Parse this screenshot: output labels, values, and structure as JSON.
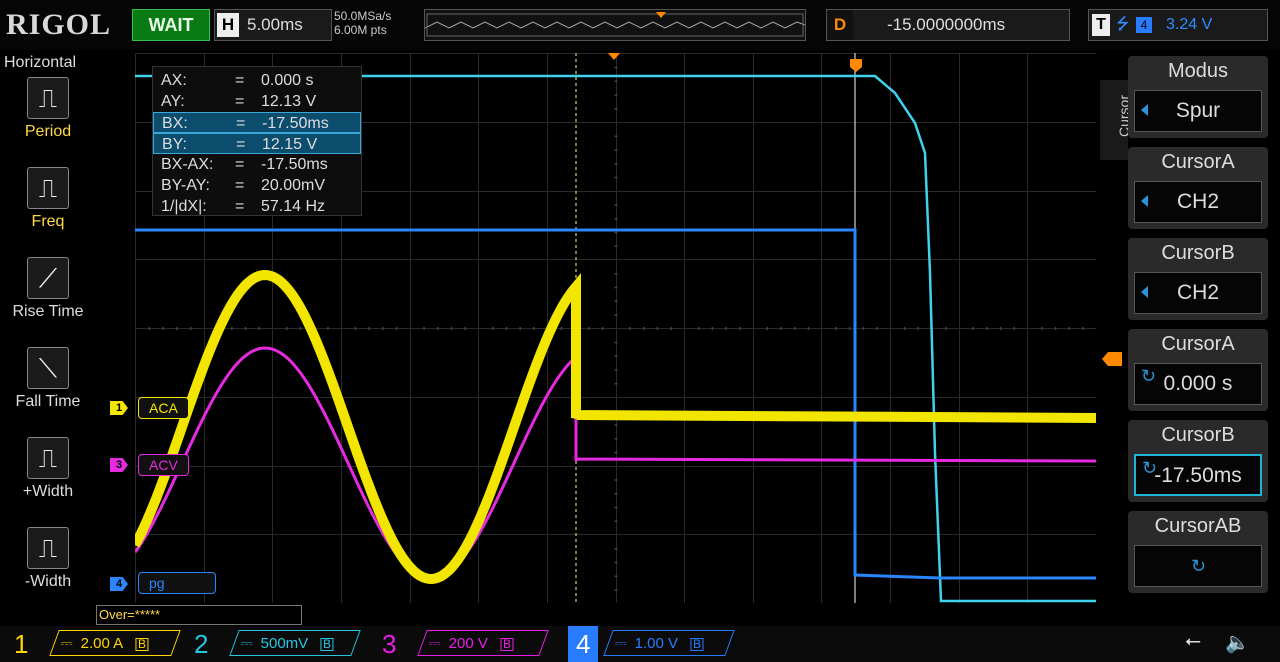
{
  "brand": "RIGOL",
  "status": "WAIT",
  "horizontal": {
    "key": "H",
    "timebase": "5.00ms",
    "sample_rate": "50.0MSa/s",
    "memory_depth": "6.00M pts"
  },
  "delay": {
    "key": "D",
    "value": "-15.0000000ms"
  },
  "trigger": {
    "key": "T",
    "level": "3.24 V"
  },
  "left_menu": {
    "title": "Horizontal",
    "items": [
      {
        "label": "Period",
        "color": "yellow"
      },
      {
        "label": "Freq",
        "color": "yellow"
      },
      {
        "label": "Rise Time",
        "color": "white"
      },
      {
        "label": "Fall Time",
        "color": "white"
      },
      {
        "label": "+Width",
        "color": "white"
      },
      {
        "label": "-Width",
        "color": "white"
      }
    ]
  },
  "cursor_readout": [
    {
      "k": "AX:",
      "v": "0.000 s",
      "hl": false
    },
    {
      "k": "AY:",
      "v": "12.13 V",
      "hl": false
    },
    {
      "k": "BX:",
      "v": "-17.50ms",
      "hl": true
    },
    {
      "k": "BY:",
      "v": "12.15 V",
      "hl": true
    },
    {
      "k": "BX-AX:",
      "v": "-17.50ms",
      "hl": false
    },
    {
      "k": "BY-AY:",
      "v": "20.00mV",
      "hl": false
    },
    {
      "k": "1/|dX|:",
      "v": "57.14 Hz",
      "hl": false
    }
  ],
  "readout_eq": "=",
  "channel_labels": {
    "ch1": "ACA",
    "ch3": "ACV",
    "ch4": "pg"
  },
  "channel_numbers": {
    "ch1": "1",
    "ch3": "3",
    "ch4": "4"
  },
  "over": "Over=*****",
  "right_menu": {
    "side_label": "Cursor",
    "buttons": [
      {
        "header": "Modus",
        "value": "Spur",
        "arrow": true,
        "selected": false,
        "rotate": false
      },
      {
        "header": "CursorA",
        "value": "CH2",
        "arrow": true,
        "selected": false,
        "rotate": false
      },
      {
        "header": "CursorB",
        "value": "CH2",
        "arrow": true,
        "selected": false,
        "rotate": false
      },
      {
        "header": "CursorA",
        "value": "0.000 s",
        "arrow": false,
        "selected": false,
        "rotate": true
      },
      {
        "header": "CursorB",
        "value": "-17.50ms",
        "arrow": false,
        "selected": true,
        "rotate": true
      },
      {
        "header": "CursorAB",
        "value": "",
        "arrow": false,
        "selected": false,
        "rotate": true
      }
    ]
  },
  "channels": [
    {
      "num": "1",
      "scale": "2.00 A",
      "color": "#ffd400"
    },
    {
      "num": "2",
      "scale": "500mV",
      "color": "#27c6e0"
    },
    {
      "num": "3",
      "scale": "200 V",
      "color": "#e91ee6"
    },
    {
      "num": "4",
      "scale": "1.00 V",
      "color": "#2a7cff"
    }
  ],
  "colors": {
    "ch1": "#f2e600",
    "ch2": "#3fd2ea",
    "ch3": "#e62ae0",
    "ch4": "#2a86ff",
    "trigger": "#ff8a00"
  }
}
